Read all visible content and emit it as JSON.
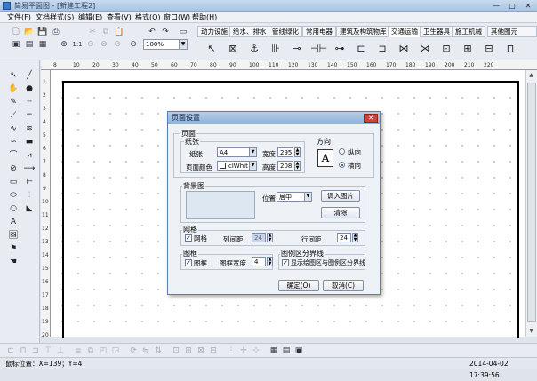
{
  "window": {
    "title": "简易平面图 - [新建工程2]",
    "min": "—",
    "max": "□",
    "close": "✕"
  },
  "menu": [
    "文件(F)",
    "文档样式(S)",
    "编辑(E)",
    "查看(V)",
    "格式(O)",
    "窗口(W)",
    "帮助(H)"
  ],
  "toolbar": {
    "zoom_value": "100%"
  },
  "category_tabs": [
    "动力设施",
    "给水、排水",
    "管线绿化",
    "常用电器",
    "建筑及构筑物库",
    "交通运输",
    "卫生器具",
    "施工机械",
    "其他图元"
  ],
  "active_tab_index": 5,
  "symbols": [
    "⬚",
    "⊠",
    "⚓",
    "⊪",
    "⊸",
    "⊣⊢",
    "⊶",
    "⊏",
    "⊐",
    "⋈",
    "⋊",
    "⊡",
    "⊞",
    "⊟",
    "⊓"
  ],
  "ruler_top_ticks": [
    "8",
    "10",
    "20",
    "30",
    "40",
    "50",
    "60",
    "70",
    "80",
    "90",
    "100",
    "110",
    "120",
    "130",
    "140",
    "150",
    "160",
    "170",
    "180",
    "190",
    "200",
    "210",
    "220"
  ],
  "ruler_left_ticks": [
    "1",
    "2",
    "3",
    "4",
    "5",
    "6",
    "7",
    "8",
    "9",
    "10",
    "11",
    "12",
    "13",
    "14",
    "15",
    "16",
    "17",
    "18",
    "19",
    "20"
  ],
  "dialog": {
    "title": "页面设置",
    "page_group": "页面",
    "paper_group": "纸张",
    "paper_label": "纸张",
    "paper_value": "A4",
    "width_label": "宽度",
    "width_value": "295",
    "page_color_label": "页面颜色",
    "page_color_value": "clWhit",
    "height_label": "高度",
    "height_value": "208",
    "orientation_group": "方向",
    "portrait_label": "纵向",
    "landscape_label": "横向",
    "orientation_selected": "横向",
    "background_group": "背景图",
    "position_label": "位置",
    "position_value": "居中",
    "import_button": "调入图片",
    "clear_button": "清除",
    "grid_group": "网格",
    "grid_checkbox": "网格",
    "col_spacing_label": "列间距",
    "col_spacing_value": "24",
    "row_spacing_label": "行间距",
    "row_spacing_value": "24",
    "frame_group": "图框",
    "frame_checkbox": "图框",
    "frame_width_label": "图框宽度",
    "frame_width_value": "4",
    "divider_group": "图例区分界线",
    "divider_checkbox": "显示绘图区与图例区分界线",
    "ok_button": "确定(O)",
    "cancel_button": "取消(C)"
  },
  "status": {
    "position": "鼠标位置：X=139；Y=4",
    "datetime": "2014-04-02  17:39:56"
  }
}
